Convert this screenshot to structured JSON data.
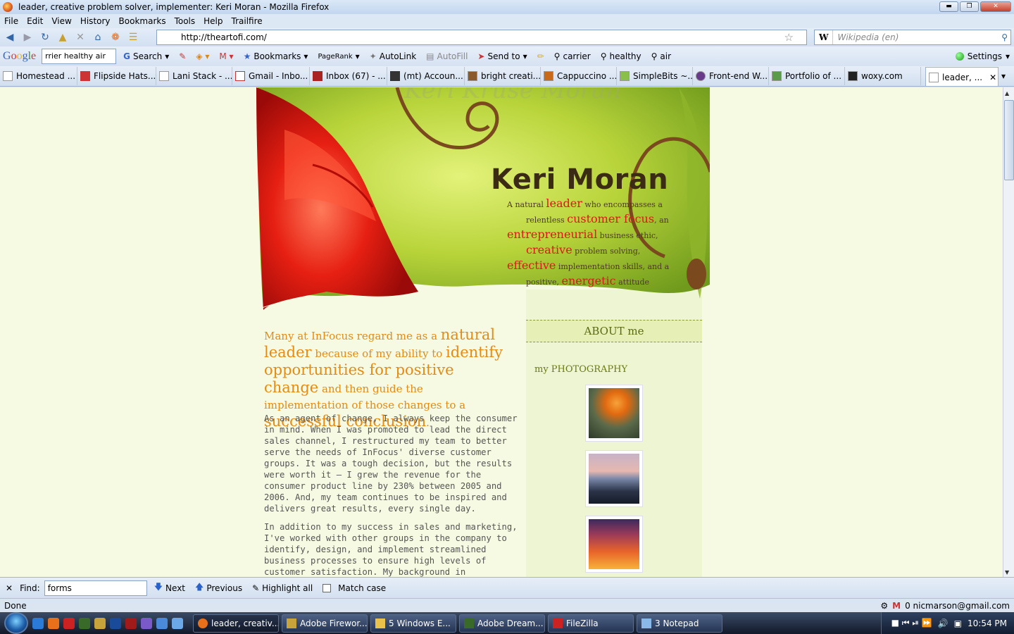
{
  "window": {
    "title": "leader, creative problem solver, implementer: Keri Moran - Mozilla Firefox"
  },
  "menu": [
    "File",
    "Edit",
    "View",
    "History",
    "Bookmarks",
    "Tools",
    "Help",
    "Trailfire"
  ],
  "nav": {
    "url": "http://theartofi.com/",
    "search_placeholder": "Wikipedia (en)",
    "search_engine_icon": "W"
  },
  "googlebar": {
    "logo": "Google",
    "query": "rrier healthy air",
    "search_label": "Search",
    "bookmarks_label": "Bookmarks",
    "pagerank_label": "PageRank",
    "autolink_label": "AutoLink",
    "autofill_label": "AutoFill",
    "sendto_label": "Send to",
    "terms": [
      "carrier",
      "healthy",
      "air"
    ],
    "settings_label": "Settings"
  },
  "bookmarks": [
    "Homestead ...",
    "Flipside Hats...",
    "Lani Stack - ...",
    "Gmail - Inbo...",
    "Inbox (67) - ...",
    "(mt) Accoun...",
    "bright creati...",
    "Cappuccino ...",
    "SimpleBits ~...",
    "Front-end W...",
    "Portfolio of ...",
    "woxy.com",
    "leader, ..."
  ],
  "page": {
    "watermark": "Keri Kruse Moran",
    "site_title": "Keri Moran",
    "tagline": [
      {
        "t": "A natural ",
        "hl": false
      },
      {
        "t": "leader",
        "hl": true
      },
      {
        "t": " who encompasses a",
        "hl": false
      },
      {
        "t": "relentless ",
        "hl": false
      },
      {
        "t": "customer focus",
        "hl": true
      },
      {
        "t": ", an",
        "hl": false
      },
      {
        "t": "entrepreneurial",
        "hl": true
      },
      {
        "t": " business ethic,",
        "hl": false
      },
      {
        "t": "creative",
        "hl": true
      },
      {
        "t": " problem solving,",
        "hl": false
      },
      {
        "t": "effective",
        "hl": true
      },
      {
        "t": " implementation skills, and a",
        "hl": false
      },
      {
        "t": "positive, ",
        "hl": false
      },
      {
        "t": "energetic",
        "hl": true
      },
      {
        "t": " attitude",
        "hl": false
      }
    ],
    "about_heading": "ABOUT me",
    "photo_heading": "my PHOTOGRAPHY",
    "lead": [
      {
        "t": "Many at InFocus regard me as a ",
        "big": false
      },
      {
        "t": "natural leader",
        "big": true
      },
      {
        "t": " because of my ability to ",
        "big": false
      },
      {
        "t": "identify opportunities for positive change",
        "big": true
      },
      {
        "t": " and then guide the implementation of those changes to a ",
        "big": false
      },
      {
        "t": "successful conclusion",
        "big": true
      },
      {
        "t": ".",
        "big": false
      }
    ],
    "paragraph1": "As an agent of change, I always keep the consumer in mind. When I was promoted to lead the direct sales channel, I restructured my team to better serve the needs of InFocus' diverse customer groups. It was a tough decision, but the results were worth it —  I grew the revenue for the consumer product line by 230% between 2005 and 2006. And, my team continues to be inspired and delivers great results, every single day.",
    "paragraph2": "In addition to my success in sales and marketing, I've worked with other groups in the company to identify, design, and implement streamlined business processes to ensure high levels of customer satisfaction. My background in development and design and comfort"
  },
  "findbar": {
    "label": "Find:",
    "query": "forms",
    "next": "Next",
    "previous": "Previous",
    "highlight": "Highlight all",
    "matchcase": "Match case"
  },
  "status": {
    "text": "Done",
    "email": "0 nicmarson@gmail.com"
  },
  "taskbar": {
    "tasks": [
      "leader, creativ...",
      "Adobe Firewor...",
      "5 Windows E...",
      "Adobe Dream...",
      "FileZilla",
      "3 Notepad"
    ],
    "clock": "10:54 PM"
  },
  "colors": {
    "page_bg": "#f6fae3",
    "accent_red": "#e0151c",
    "lead_orange": "#e58a12",
    "sidebar_green": "#eef5d2"
  }
}
